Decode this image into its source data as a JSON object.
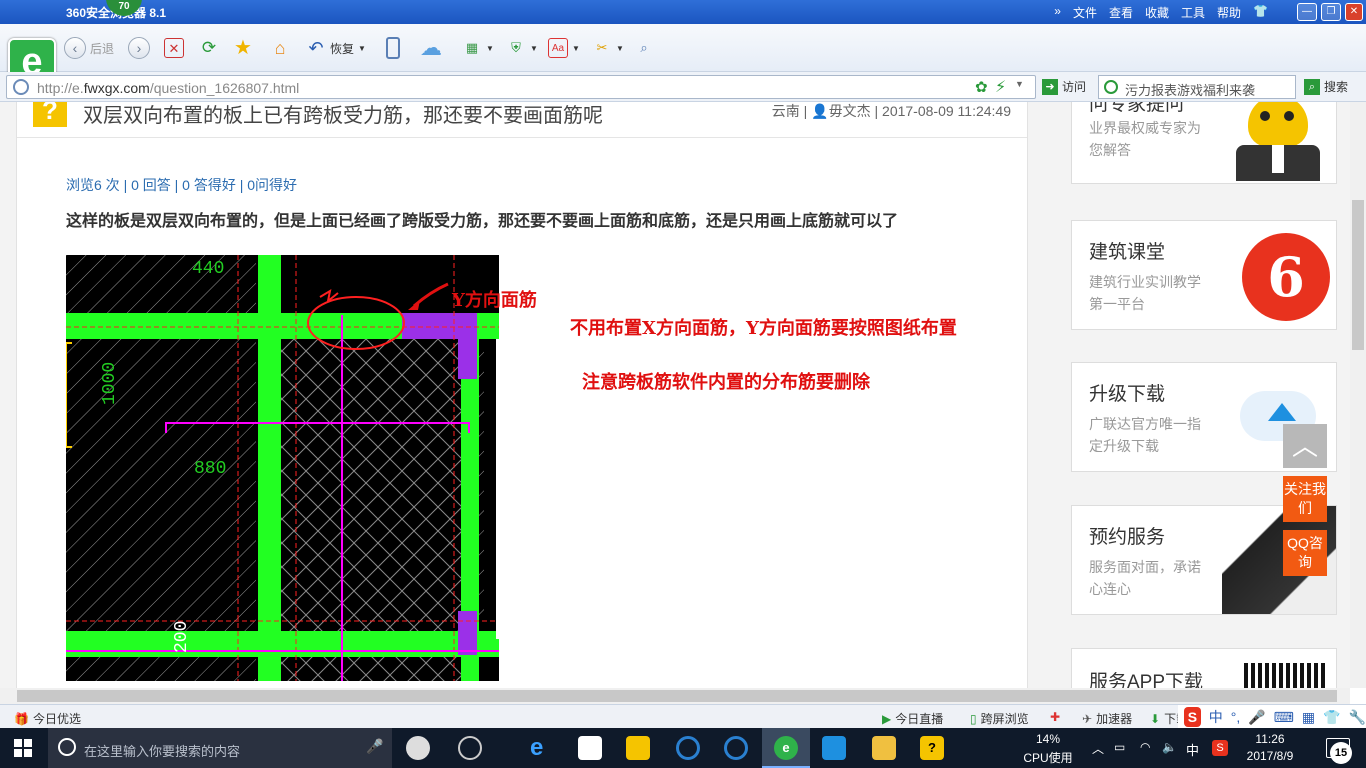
{
  "browser": {
    "title": "360安全浏览器 8.1",
    "badge": "70",
    "menu": [
      "文件",
      "查看",
      "收藏",
      "工具",
      "帮助"
    ],
    "back_label": "后退",
    "restore_label": "恢复",
    "url_prefix": "http://e.",
    "url_domain": "fwxgx.com",
    "url_path": "/question_1626807.html",
    "visit_label": "访问",
    "search_placeholder": "污力报表游戏福利来袭",
    "search_button": "搜索"
  },
  "article": {
    "title": "双层双向布置的板上已有跨板受力筋，那还要不要画面筋呢",
    "location": "云南",
    "author": "毋文杰",
    "datetime": "2017-08-09 11:24:49",
    "stats": "浏览6 次 | 0 回答 | 0 答得好 | 0问得好",
    "body": "这样的板是双层双向布置的，但是上面已经画了跨版受力筋，那还要不要画上面筋和底筋，还是只用画上底筋就可以了"
  },
  "cad": {
    "dim_440": "440",
    "dim_1000": "1000",
    "dim_880": "880",
    "dim_200": "200"
  },
  "annotations": {
    "y_top_bar": "Y方向面筋",
    "instruction_1": "不用布置X方向面筋，Y方向面筋要按照图纸布置",
    "instruction_2": "注意跨板筋软件内置的分布筋要删除"
  },
  "sidebar": [
    {
      "title": "问专家提问",
      "desc": "业界最权威专家为您解答"
    },
    {
      "title": "建筑课堂",
      "desc": "建筑行业实训教学第一平台"
    },
    {
      "title": "升级下载",
      "desc": "广联达官方唯一指定升级下载"
    },
    {
      "title": "预约服务",
      "desc": "服务面对面，承诺心连心"
    },
    {
      "title": "服务APP下载",
      "desc": ""
    }
  ],
  "float_buttons": {
    "follow": "关注我们",
    "qq": "QQ咨询"
  },
  "statusbar": {
    "left": "今日优选",
    "live": "今日直播",
    "cross_screen": "跨屏浏览",
    "accelerator": "加速器",
    "download": "下载"
  },
  "ime": {
    "lang": "中"
  },
  "taskbar": {
    "search_placeholder": "在这里输入你要搜索的内容",
    "cpu_percent": "14%",
    "cpu_label": "CPU使用",
    "ime_lang": "中",
    "time": "11:26",
    "date": "2017/8/9",
    "notification_count": "15"
  },
  "colors": {
    "accent_blue": "#2b6cb0",
    "cad_green": "#22ff22",
    "cad_magenta": "#ff00ff",
    "annotation_red": "#e01010",
    "orange": "#f25a12"
  }
}
